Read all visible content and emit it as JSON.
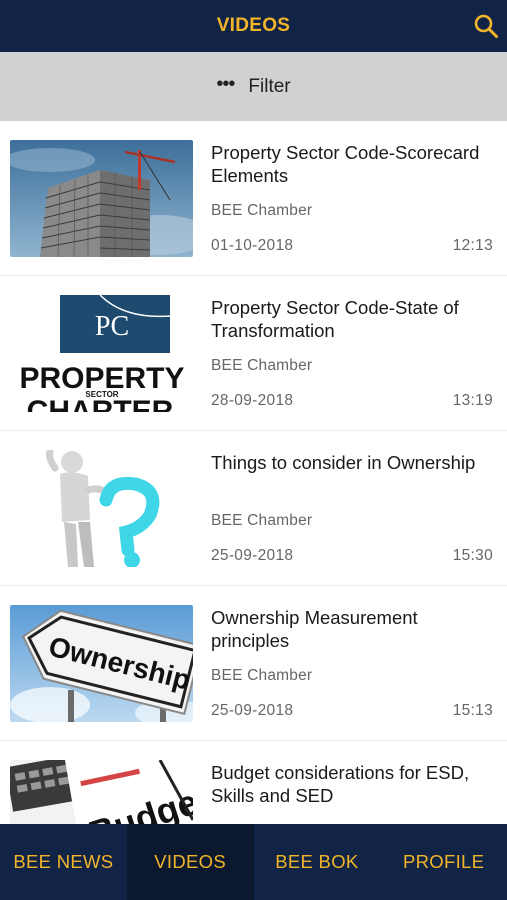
{
  "header": {
    "title": "VIDEOS",
    "search_icon": "search-icon"
  },
  "filter": {
    "icon": "more-dots-icon",
    "label": "Filter"
  },
  "videos": [
    {
      "title": "Property Sector Code-Scorecard Elements",
      "author": "BEE Chamber",
      "date": "01-10-2018",
      "duration": "12:13",
      "thumb": "building-under-construction-image"
    },
    {
      "title": "Property Sector Code-State of Transformation",
      "author": "BEE Chamber",
      "date": "28-09-2018",
      "duration": "13:19",
      "thumb": "property-sector-charter-logo",
      "thumb_text": {
        "monogram": "PC",
        "word1": "PROPERTY",
        "sub": "SECTOR",
        "word2": "CHARTER"
      }
    },
    {
      "title": "Things to consider in Ownership",
      "author": "BEE Chamber",
      "date": "25-09-2018",
      "duration": "15:30",
      "thumb": "figure-with-question-mark-image"
    },
    {
      "title": "Ownership Measurement principles",
      "author": "BEE Chamber",
      "date": "25-09-2018",
      "duration": "15:13",
      "thumb": "ownership-sign-image",
      "thumb_text": {
        "sign": "Ownership"
      }
    },
    {
      "title": "Budget considerations for ESD, Skills and SED",
      "author": "",
      "date": "",
      "duration": "",
      "thumb": "budget-calculator-image",
      "thumb_text": {
        "word": "Budget"
      }
    }
  ],
  "nav": {
    "tabs": [
      {
        "label": "BEE NEWS",
        "active": false
      },
      {
        "label": "VIDEOS",
        "active": true
      },
      {
        "label": "BEE BOK",
        "active": false
      },
      {
        "label": "PROFILE",
        "active": false
      }
    ]
  },
  "colors": {
    "navy": "#122445",
    "gold": "#f2b52a",
    "filter_bg": "#d1d1d3"
  }
}
